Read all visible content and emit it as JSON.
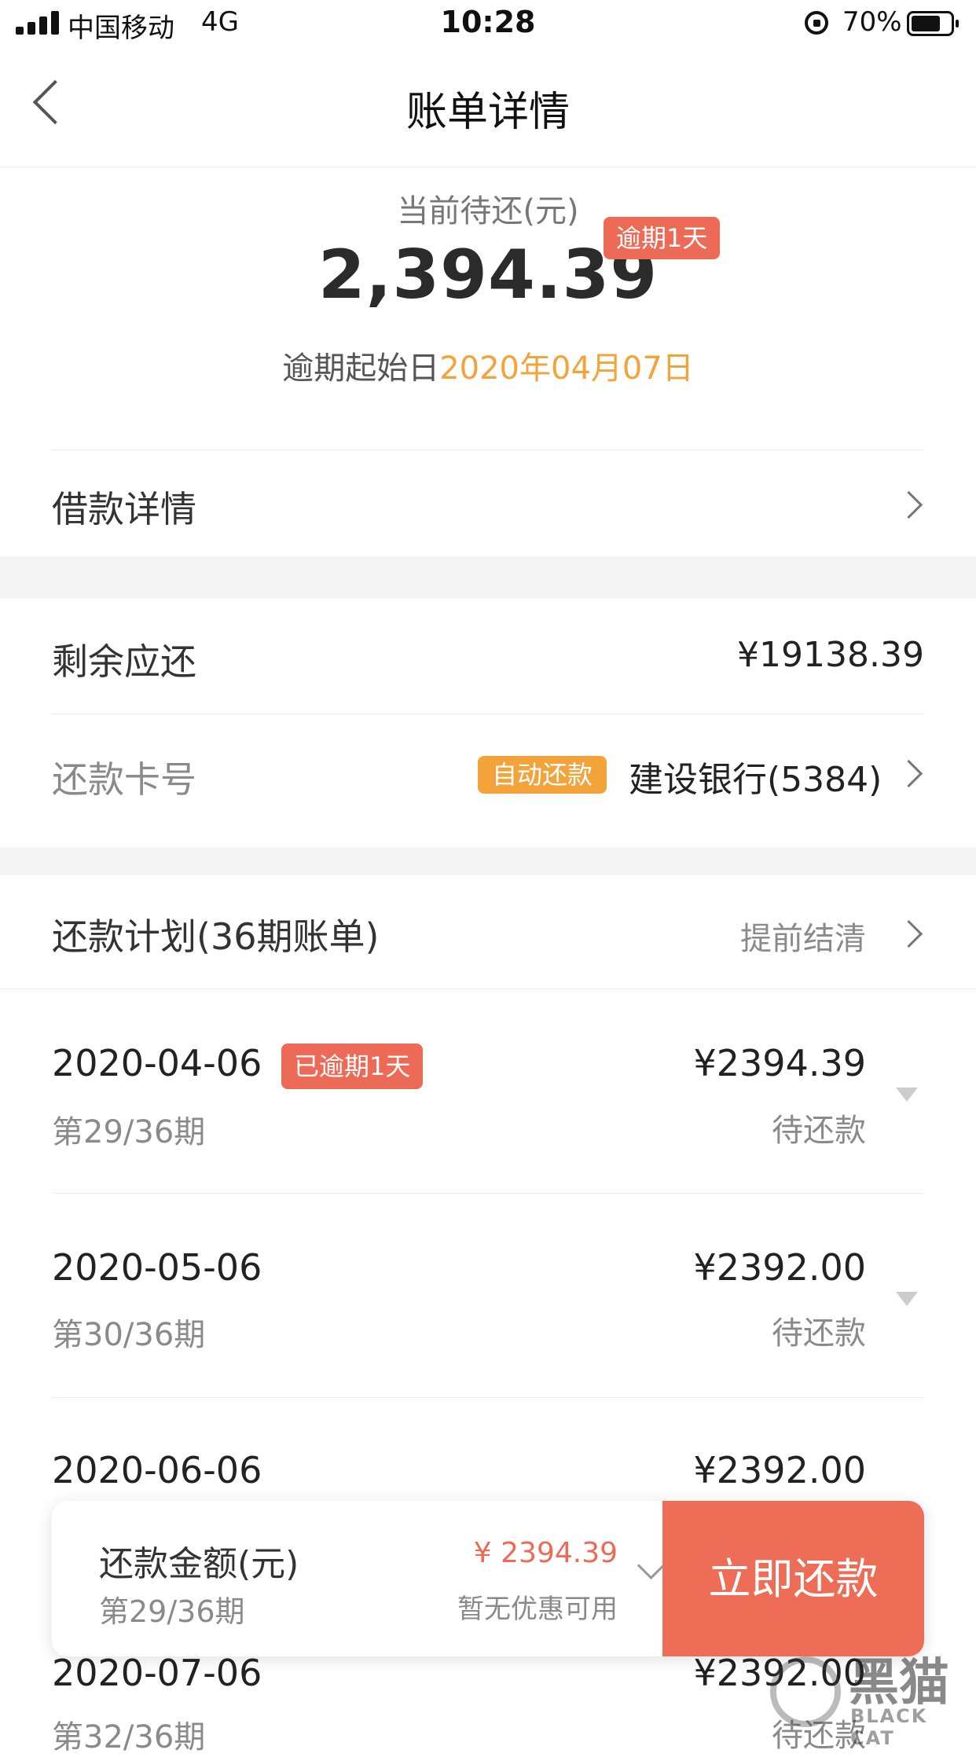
{
  "status_bar": {
    "carrier": "中国移动",
    "network": "4G",
    "time": "10:28",
    "battery": "70%"
  },
  "nav": {
    "title": "账单详情"
  },
  "summary": {
    "label": "当前待还(元)",
    "amount": "2,394.39",
    "overdue_tag": "逾期1天",
    "start_prefix": "逾期起始日",
    "start_date": "2020年04月07日"
  },
  "loan_details": {
    "label": "借款详情"
  },
  "remaining": {
    "label": "剩余应还",
    "value": "¥19138.39"
  },
  "card": {
    "label": "还款卡号",
    "auto_tag": "自动还款",
    "bank": "建设银行(5384)"
  },
  "plan": {
    "title": "还款计划(36期账单)",
    "early_settle": "提前结清",
    "items": [
      {
        "date": "2020-04-06",
        "tag": "已逾期1天",
        "period": "第29/36期",
        "amount": "¥2394.39",
        "status": "待还款"
      },
      {
        "date": "2020-05-06",
        "tag": "",
        "period": "第30/36期",
        "amount": "¥2392.00",
        "status": "待还款"
      },
      {
        "date": "2020-06-06",
        "tag": "",
        "period": "",
        "amount": "¥2392.00",
        "status": ""
      },
      {
        "date": "2020-07-06",
        "tag": "",
        "period": "第32/36期",
        "amount": "¥2392.00",
        "status": "待还款"
      }
    ]
  },
  "pay_bar": {
    "label": "还款金额(元)",
    "period": "第29/36期",
    "amount": "¥ 2394.39",
    "discount": "暂无优惠可用",
    "button": "立即还款"
  },
  "watermark": {
    "text": "黑猫",
    "sub": "BLACK CAT"
  },
  "colors": {
    "accent": "#ed6a56",
    "orange": "#f4a23a"
  }
}
